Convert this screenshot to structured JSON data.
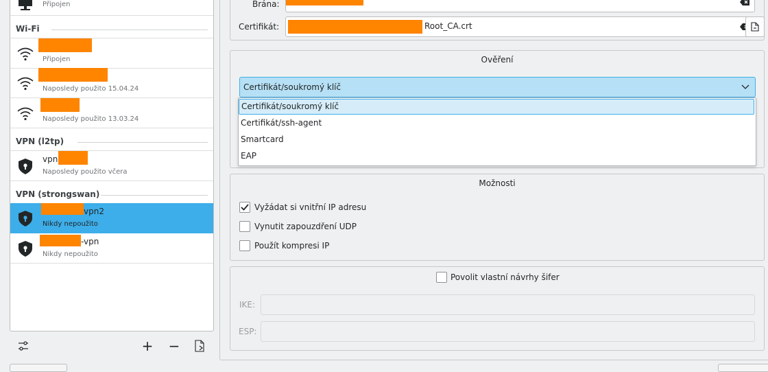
{
  "left": {
    "top_item": {
      "sub": "Připojen"
    },
    "sections": [
      {
        "title": "Wi-Fi"
      },
      {
        "title": "VPN (l2tp)"
      },
      {
        "title": "VPN (strongswan)"
      }
    ],
    "wifi": [
      {
        "sub": "Připojen"
      },
      {
        "sub": "Naposledy použito 15.04.24"
      },
      {
        "sub": "Naposledy použito 13.03.24"
      }
    ],
    "l2tp": [
      {
        "name_prefix": "vpn",
        "sub": "Naposledy použito včera"
      }
    ],
    "strongswan": [
      {
        "name_suffix": "vpn2",
        "sub": "Nikdy nepoužito",
        "selected": true
      },
      {
        "name_suffix": "-vpn",
        "sub": "Nikdy nepoužito"
      }
    ],
    "toolbar": {
      "configure": "configure-icon",
      "add": "+",
      "remove": "−",
      "export": "export-icon"
    }
  },
  "right": {
    "gateway_label": "Brána:",
    "cert_label": "Certifikát:",
    "cert_value_suffix": "Root_CA.crt",
    "auth": {
      "title": "Ověření",
      "selected": "Certifikát/soukromý klíč",
      "options": [
        "Certifikát/soukromý klíč",
        "Certifikát/ssh-agent",
        "Smartcard",
        "EAP"
      ]
    },
    "options": {
      "title": "Možnosti",
      "items": [
        {
          "label": "Vyžádat si vnitřní IP adresu",
          "checked": true
        },
        {
          "label": "Vynutit zapouzdření UDP",
          "checked": false
        },
        {
          "label": "Použít kompresi IP",
          "checked": false
        }
      ]
    },
    "ciphers": {
      "toggle_label": "Povolit vlastní návrhy šifer",
      "checked": false,
      "ike_label": "IKE:",
      "esp_label": "ESP:"
    }
  },
  "colors": {
    "accent": "#3daee9",
    "redaction": "#ff8400",
    "selection": "#3daee9"
  }
}
